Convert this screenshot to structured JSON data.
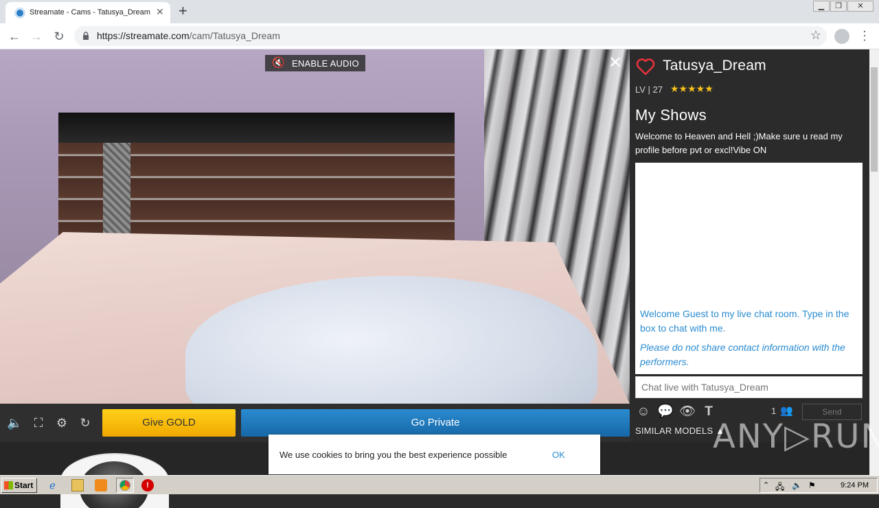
{
  "browser": {
    "tab_title": "Streamate - Cams - Tatusya_Dream",
    "url_domain": "https://streamate.com",
    "url_path": "/cam/Tatusya_Dream"
  },
  "video": {
    "enable_audio_label": "ENABLE AUDIO",
    "give_gold_label": "Give GOLD",
    "go_private_label": "Go Private"
  },
  "cookie": {
    "text": "We use cookies to bring you the best experience possible",
    "ok_label": "OK"
  },
  "model": {
    "name": "Tatusya_Dream",
    "level_text": "LV | 27",
    "stars": "★★★★★",
    "star_rating": 5
  },
  "shows": {
    "title": "My Shows",
    "description": "Welcome to Heaven and Hell ;)Make sure u read my profile before pvt or excl!Vibe ON"
  },
  "chat": {
    "welcome": "Welcome Guest to my live chat room. Type in the box to chat with me.",
    "warning": "Please do not share contact information with the performers.",
    "placeholder": "Chat live with Tatusya_Dream",
    "viewer_count": "1",
    "send_label": "Send",
    "similar_models_label": "SIMILAR MODELS ▲"
  },
  "watermark": "ANY▷RUN",
  "taskbar": {
    "start_label": "Start",
    "clock": "9:24 PM"
  },
  "colors": {
    "accent_blue": "#2a8bd0",
    "gold": "#f0a800",
    "heart_red": "#e8323c",
    "star_yellow": "#f7c21a"
  }
}
